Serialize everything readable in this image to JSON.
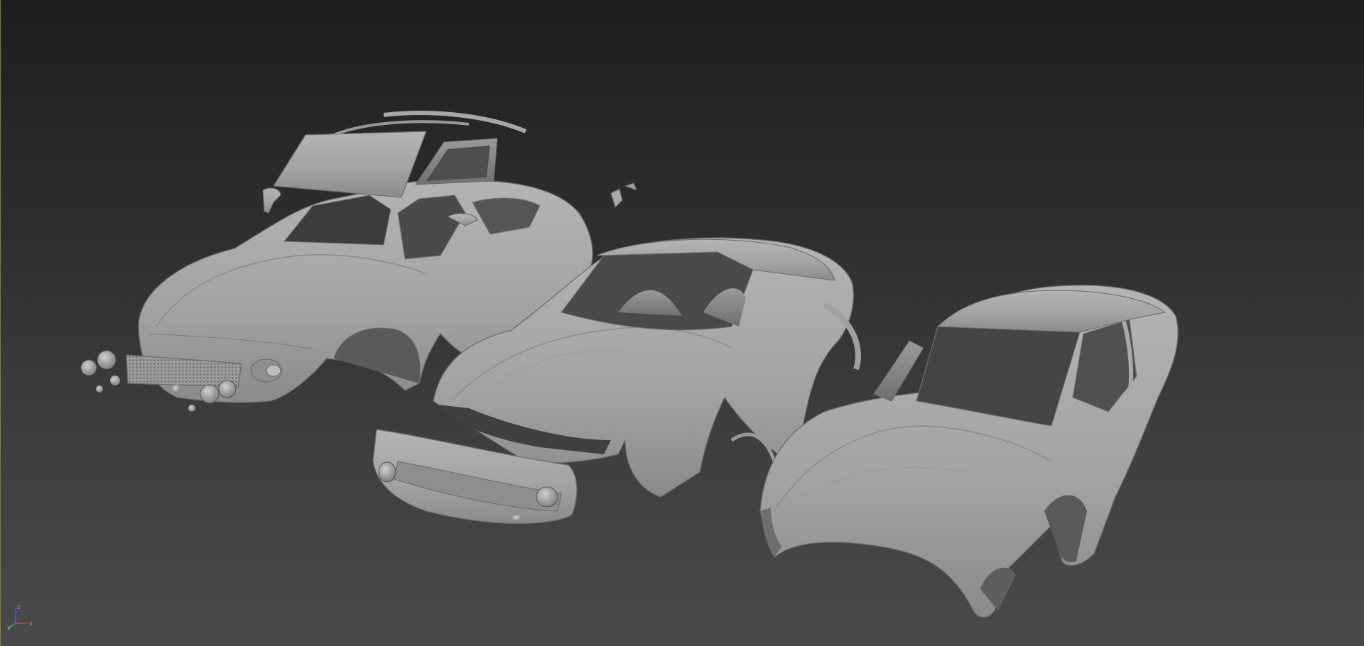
{
  "viewport": {
    "background_top": "#1e1e1e",
    "background_bottom": "#4a4a4a",
    "border_color": "#8a7a3a"
  },
  "scene": {
    "objects": [
      {
        "name": "car-body-exploded",
        "state": "exploded parts"
      },
      {
        "name": "car-body-with-bumper",
        "state": "front bumper detached"
      },
      {
        "name": "car-body-shell",
        "state": "shell only"
      }
    ],
    "shading": "grey clay"
  },
  "axis_gizmo": {
    "icon": "axis-tripod-icon",
    "labels": {
      "x": "x",
      "y": "y",
      "z": "z"
    },
    "colors": {
      "x": "#d04040",
      "y": "#40b040",
      "z": "#4060e0"
    }
  }
}
